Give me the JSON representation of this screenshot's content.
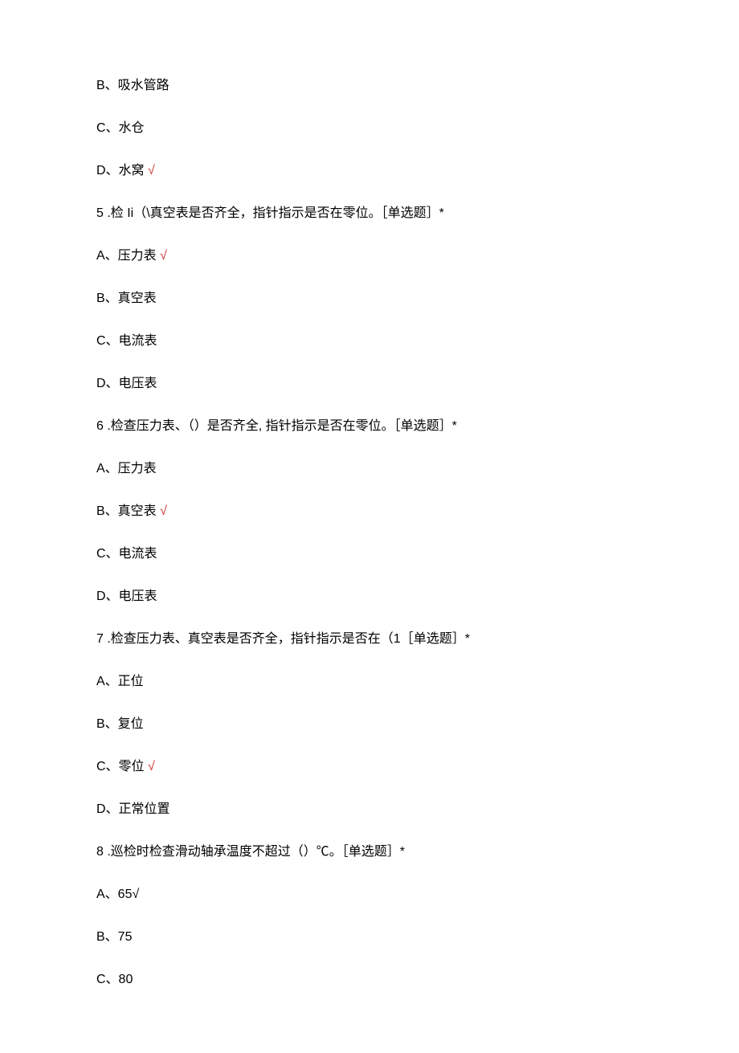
{
  "lines": [
    {
      "text": "B、吸水管路",
      "hasCheck": false
    },
    {
      "text": "C、水仓",
      "hasCheck": false
    },
    {
      "text": "D、水窝 ",
      "hasCheck": true
    },
    {
      "text": "5  .检 Ii（\\真空表是否齐全，指针指示是否在零位。［单选题］*",
      "hasCheck": false
    },
    {
      "text": "A、压力表 ",
      "hasCheck": true
    },
    {
      "text": "B、真空表",
      "hasCheck": false
    },
    {
      "text": "C、电流表",
      "hasCheck": false
    },
    {
      "text": "D、电压表",
      "hasCheck": false
    },
    {
      "text": "6  .检查压力表、（）是否齐全, 指针指示是否在零位。［单选题］*",
      "hasCheck": false
    },
    {
      "text": "A、压力表",
      "hasCheck": false
    },
    {
      "text": "B、真空表 ",
      "hasCheck": true
    },
    {
      "text": "C、电流表",
      "hasCheck": false
    },
    {
      "text": "D、电压表",
      "hasCheck": false
    },
    {
      "text": "7  .检查压力表、真空表是否齐全，指针指示是否在（1［单选题］*",
      "hasCheck": false
    },
    {
      "text": "A、正位",
      "hasCheck": false
    },
    {
      "text": "B、复位",
      "hasCheck": false
    },
    {
      "text": "C、零位 ",
      "hasCheck": true
    },
    {
      "text": "D、正常位置",
      "hasCheck": false
    },
    {
      "text": "8  .巡检时检查滑动轴承温度不超过（）℃。［单选题］*",
      "hasCheck": false
    },
    {
      "text": "A、65√",
      "hasCheck": false
    },
    {
      "text": "B、75",
      "hasCheck": false
    },
    {
      "text": "C、80",
      "hasCheck": false
    }
  ],
  "checkMark": "√"
}
